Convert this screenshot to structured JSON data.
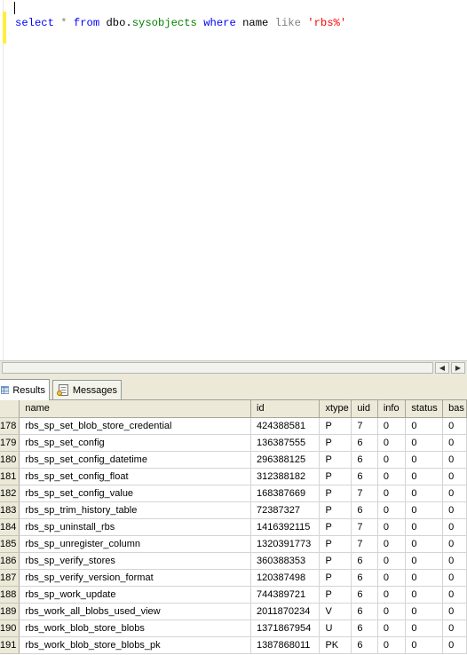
{
  "editor": {
    "tokens": [
      {
        "text": "select",
        "cls": "kw"
      },
      {
        "text": " ",
        "cls": "plain"
      },
      {
        "text": "*",
        "cls": "op"
      },
      {
        "text": " ",
        "cls": "plain"
      },
      {
        "text": "from",
        "cls": "kw"
      },
      {
        "text": " dbo.",
        "cls": "plain"
      },
      {
        "text": "sysobjects",
        "cls": "fn"
      },
      {
        "text": " ",
        "cls": "plain"
      },
      {
        "text": "where",
        "cls": "kw"
      },
      {
        "text": " name ",
        "cls": "plain"
      },
      {
        "text": "like",
        "cls": "op"
      },
      {
        "text": " ",
        "cls": "plain"
      },
      {
        "text": "'rbs%'",
        "cls": "str"
      }
    ]
  },
  "tabs": {
    "results_label": "Results",
    "messages_label": "Messages"
  },
  "grid": {
    "columns": [
      "name",
      "id",
      "xtype",
      "uid",
      "info",
      "status",
      "bas"
    ],
    "rows": [
      {
        "num": "178",
        "cells": [
          "rbs_sp_set_blob_store_credential",
          "424388581",
          "P",
          "7",
          "0",
          "0",
          "0"
        ]
      },
      {
        "num": "179",
        "cells": [
          "rbs_sp_set_config",
          "136387555",
          "P",
          "6",
          "0",
          "0",
          "0"
        ]
      },
      {
        "num": "180",
        "cells": [
          "rbs_sp_set_config_datetime",
          "296388125",
          "P",
          "6",
          "0",
          "0",
          "0"
        ]
      },
      {
        "num": "181",
        "cells": [
          "rbs_sp_set_config_float",
          "312388182",
          "P",
          "6",
          "0",
          "0",
          "0"
        ]
      },
      {
        "num": "182",
        "cells": [
          "rbs_sp_set_config_value",
          "168387669",
          "P",
          "7",
          "0",
          "0",
          "0"
        ]
      },
      {
        "num": "183",
        "cells": [
          "rbs_sp_trim_history_table",
          "72387327",
          "P",
          "6",
          "0",
          "0",
          "0"
        ]
      },
      {
        "num": "184",
        "cells": [
          "rbs_sp_uninstall_rbs",
          "1416392115",
          "P",
          "7",
          "0",
          "0",
          "0"
        ]
      },
      {
        "num": "185",
        "cells": [
          "rbs_sp_unregister_column",
          "1320391773",
          "P",
          "7",
          "0",
          "0",
          "0"
        ]
      },
      {
        "num": "186",
        "cells": [
          "rbs_sp_verify_stores",
          "360388353",
          "P",
          "6",
          "0",
          "0",
          "0"
        ]
      },
      {
        "num": "187",
        "cells": [
          "rbs_sp_verify_version_format",
          "120387498",
          "P",
          "6",
          "0",
          "0",
          "0"
        ]
      },
      {
        "num": "188",
        "cells": [
          "rbs_sp_work_update",
          "744389721",
          "P",
          "6",
          "0",
          "0",
          "0"
        ]
      },
      {
        "num": "189",
        "cells": [
          "rbs_work_all_blobs_used_view",
          "2011870234",
          "V",
          "6",
          "0",
          "0",
          "0"
        ]
      },
      {
        "num": "190",
        "cells": [
          "rbs_work_blob_store_blobs",
          "1371867954",
          "U",
          "6",
          "0",
          "0",
          "0"
        ]
      },
      {
        "num": "191",
        "cells": [
          "rbs_work_blob_store_blobs_pk",
          "1387868011",
          "PK",
          "6",
          "0",
          "0",
          "0"
        ]
      }
    ]
  }
}
